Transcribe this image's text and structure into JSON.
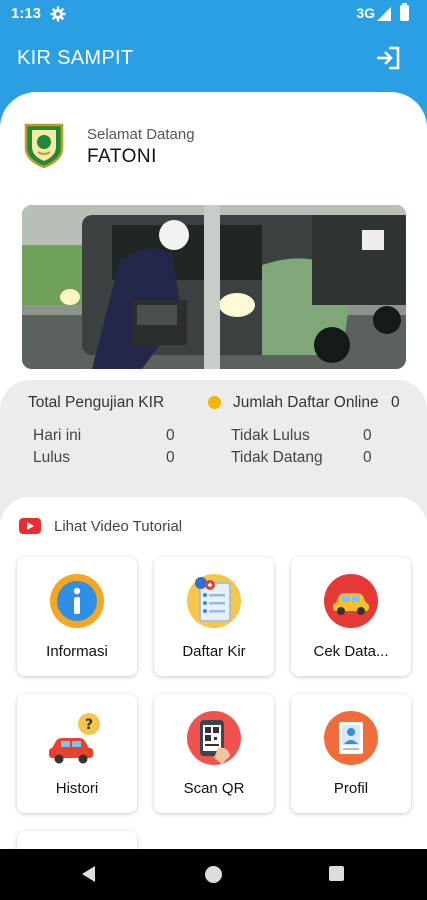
{
  "status_bar": {
    "time": "1:13",
    "network": "3G"
  },
  "app_bar": {
    "title": "KIR SAMPIT"
  },
  "welcome": {
    "greeting": "Selamat Datang",
    "name": "FATONI"
  },
  "stats": {
    "total_label": "Total Pengujian KIR",
    "online_label": "Jumlah Daftar Online",
    "online_value": "0",
    "rows": [
      {
        "label": "Hari ini",
        "value": "0"
      },
      {
        "label": "Lulus",
        "value": "0"
      },
      {
        "label": "Tidak Lulus",
        "value": "0"
      },
      {
        "label": "Tidak Datang",
        "value": "0"
      }
    ]
  },
  "tutorial": {
    "label": "Lihat Video Tutorial"
  },
  "menu": [
    {
      "label": "Informasi",
      "icon": "info-icon"
    },
    {
      "label": "Daftar Kir",
      "icon": "register-list-icon"
    },
    {
      "label": "Cek Data...",
      "icon": "car-check-icon"
    },
    {
      "label": "Histori",
      "icon": "car-history-icon"
    },
    {
      "label": "Scan QR",
      "icon": "qr-scan-icon"
    },
    {
      "label": "Profil",
      "icon": "profile-icon"
    }
  ],
  "colors": {
    "primary": "#2a9fe3",
    "accent_dot": "#f5b400",
    "youtube": "#e82a33"
  }
}
